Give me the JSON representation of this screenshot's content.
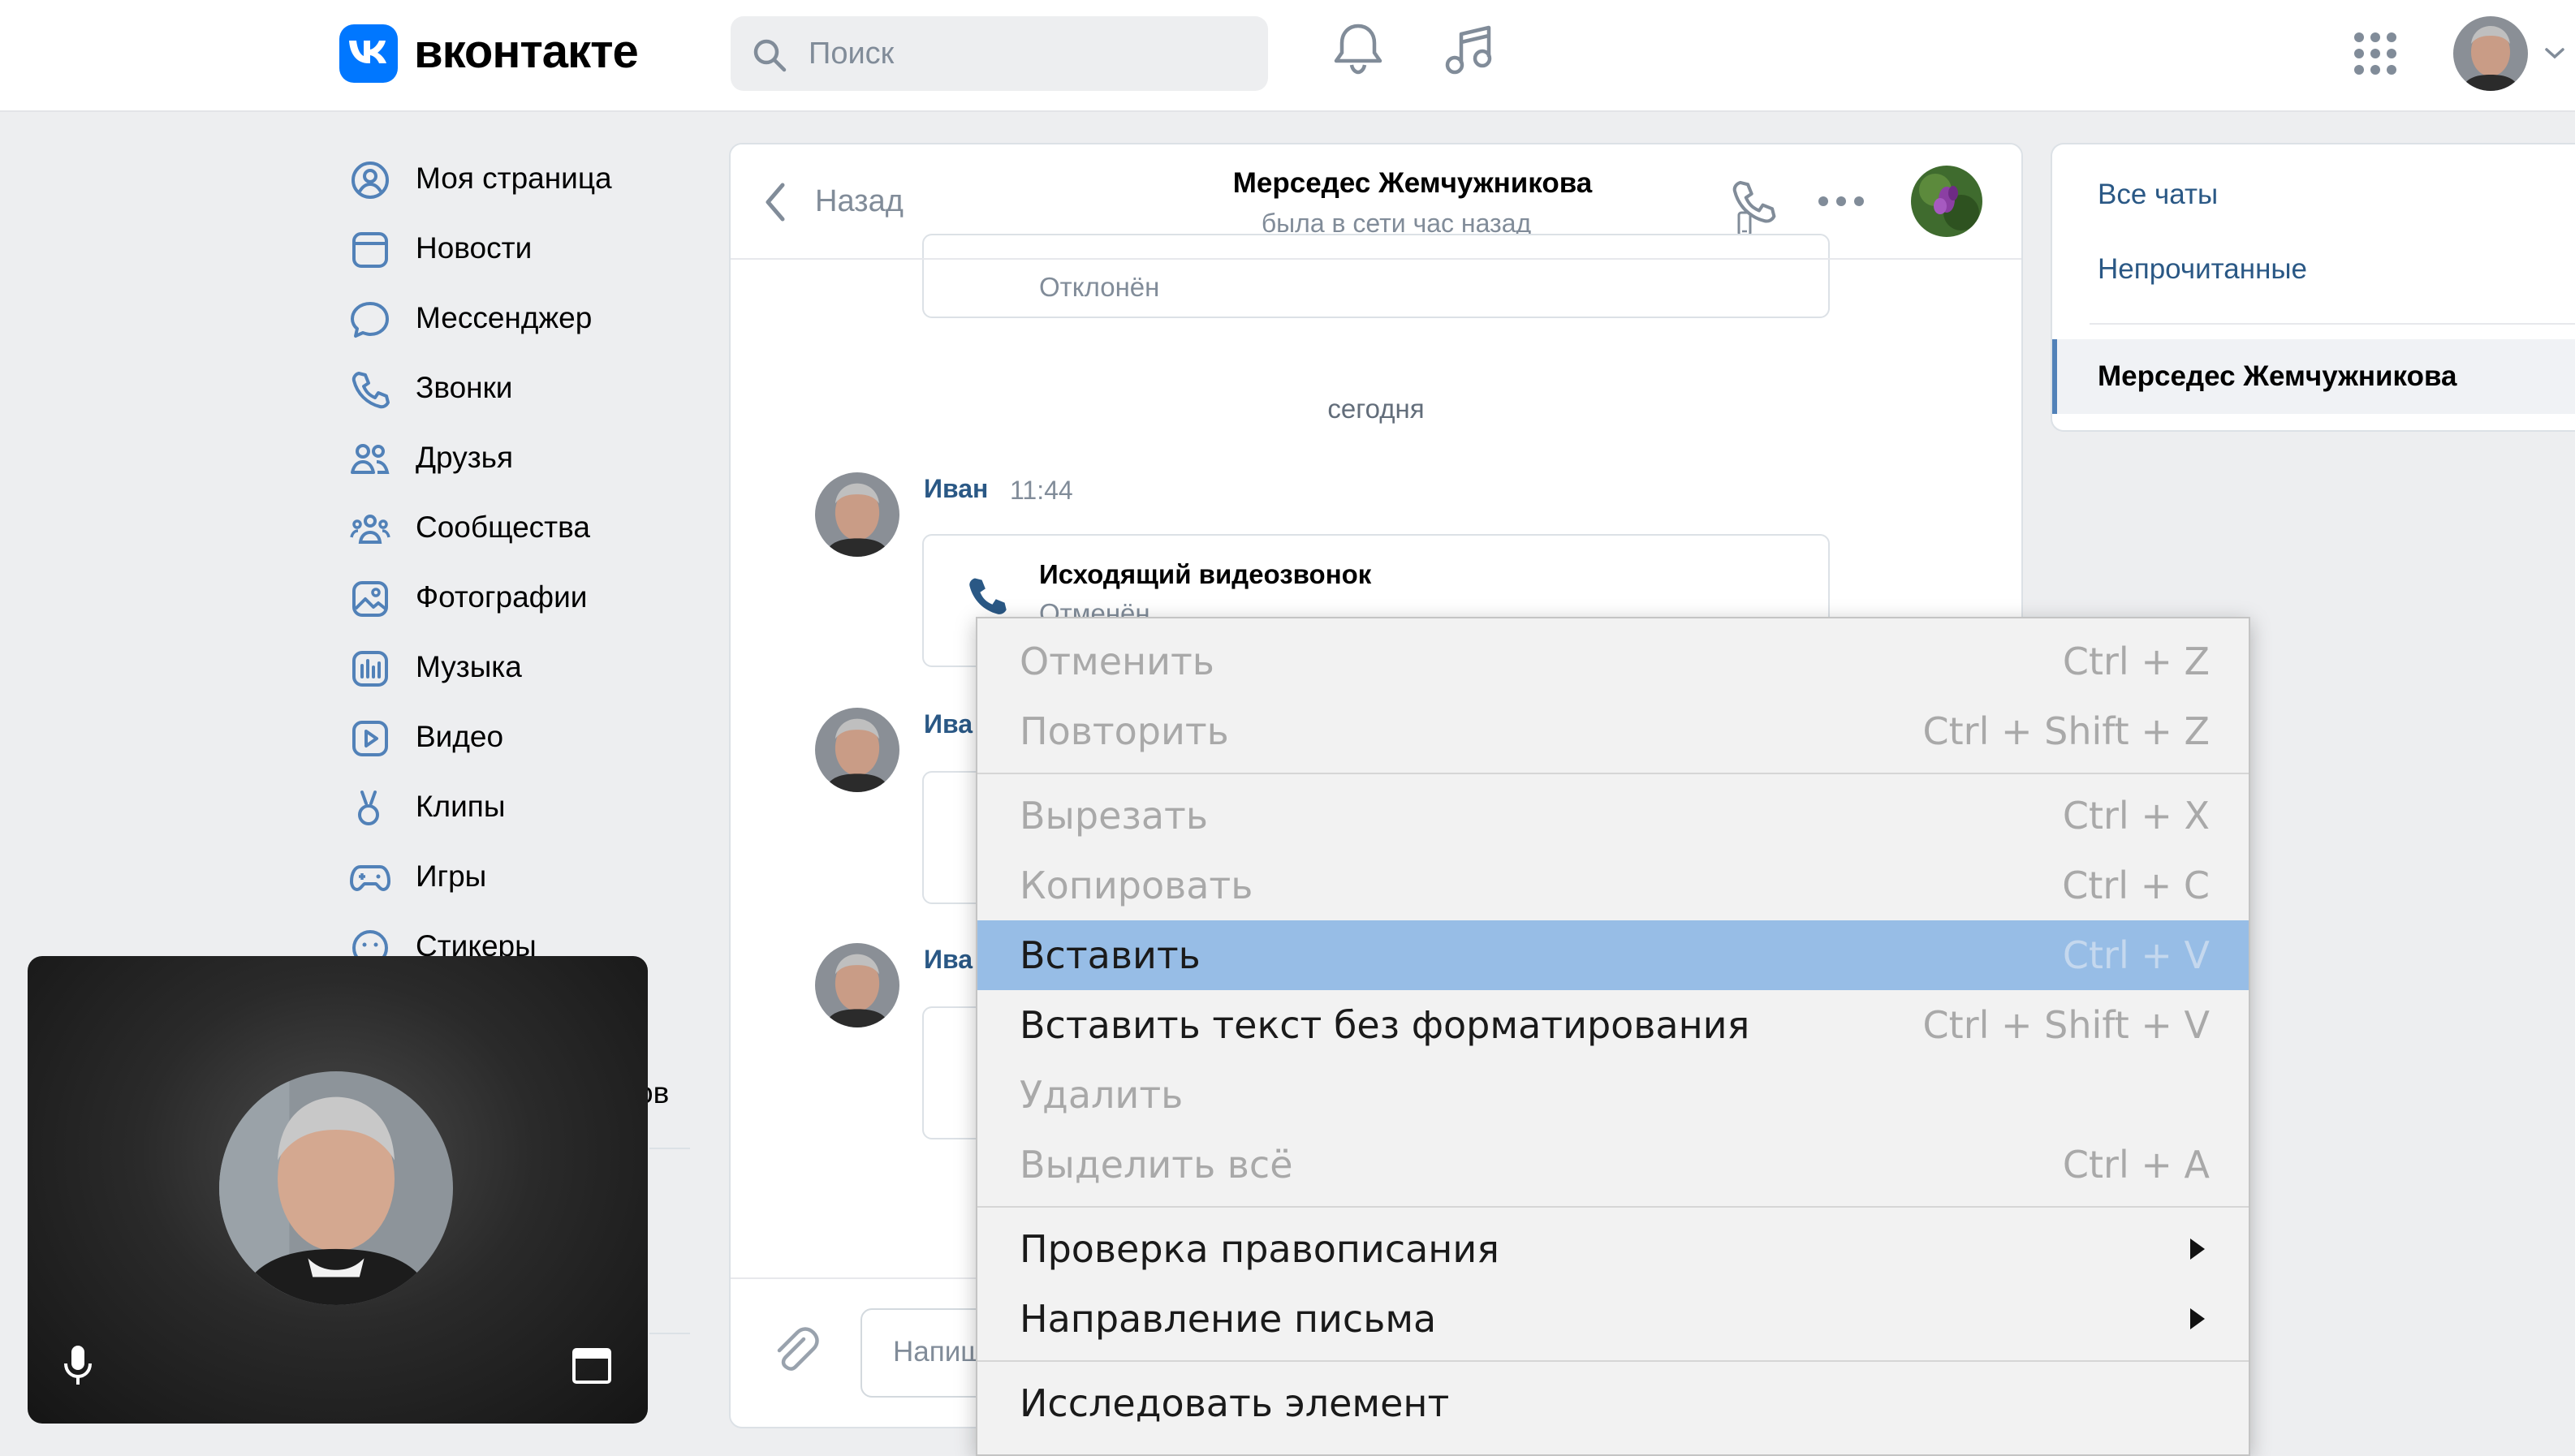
{
  "header": {
    "logo_text": "вконтакте",
    "search_placeholder": "Поиск"
  },
  "sidebar": {
    "items": [
      {
        "label": "Моя страница"
      },
      {
        "label": "Новости"
      },
      {
        "label": "Мессенджер"
      },
      {
        "label": "Звонки"
      },
      {
        "label": "Друзья"
      },
      {
        "label": "Сообщества"
      },
      {
        "label": "Фотографии"
      },
      {
        "label": "Музыка"
      },
      {
        "label": "Видео"
      },
      {
        "label": "Клипы"
      },
      {
        "label": "Игры"
      },
      {
        "label": "Стикеры"
      }
    ],
    "partial_text": "ов"
  },
  "chat": {
    "back_label": "Назад",
    "contact_name": "Мерседес Жемчужникова",
    "contact_status": "была в сети час назад",
    "first_call_status": "Отклонён",
    "date_divider": "сегодня",
    "messages": [
      {
        "author": "Иван",
        "time": "11:44",
        "call_title": "Исходящий видеозвонок",
        "call_status": "Отменён"
      },
      {
        "author": "Ива"
      },
      {
        "author": "Ива"
      }
    ],
    "input_placeholder": "Напишите сообщение..."
  },
  "right_panel": {
    "all_chats": "Все чаты",
    "unread": "Непрочитанные",
    "active_chat": "Мерседес Жемчужникова"
  },
  "context_menu": {
    "items": [
      {
        "label": "Отменить",
        "shortcut": "Ctrl + Z",
        "enabled": false
      },
      {
        "label": "Повторить",
        "shortcut": "Ctrl + Shift + Z",
        "enabled": false
      },
      {
        "label": "Вырезать",
        "shortcut": "Ctrl + X",
        "enabled": false
      },
      {
        "label": "Копировать",
        "shortcut": "Ctrl + C",
        "enabled": false
      },
      {
        "label": "Вставить",
        "shortcut": "Ctrl + V",
        "enabled": true,
        "highlighted": true
      },
      {
        "label": "Вставить текст без форматирования",
        "shortcut": "Ctrl + Shift + V",
        "enabled": true
      },
      {
        "label": "Удалить",
        "shortcut": "",
        "enabled": false
      },
      {
        "label": "Выделить всё",
        "shortcut": "Ctrl + A",
        "enabled": false
      },
      {
        "label": "Проверка правописания",
        "submenu": true,
        "enabled": true
      },
      {
        "label": "Направление письма",
        "submenu": true,
        "enabled": true
      },
      {
        "label": "Исследовать элемент",
        "enabled": true
      }
    ]
  },
  "colors": {
    "brand": "#0077ff",
    "link": "#2a5885",
    "accent_icon": "#5181b8",
    "menu_highlight": "#97bde6",
    "page_bg": "#edeef0"
  },
  "icons": [
    "vk-logo-icon",
    "search-icon",
    "bell-icon",
    "music-icon",
    "apps-grid-icon",
    "chevron-down-icon",
    "back-chevron-icon",
    "phone-icon",
    "more-icon",
    "attach-icon",
    "microphone-icon",
    "window-icon",
    "mobile-icon",
    "submenu-arrow-icon"
  ]
}
